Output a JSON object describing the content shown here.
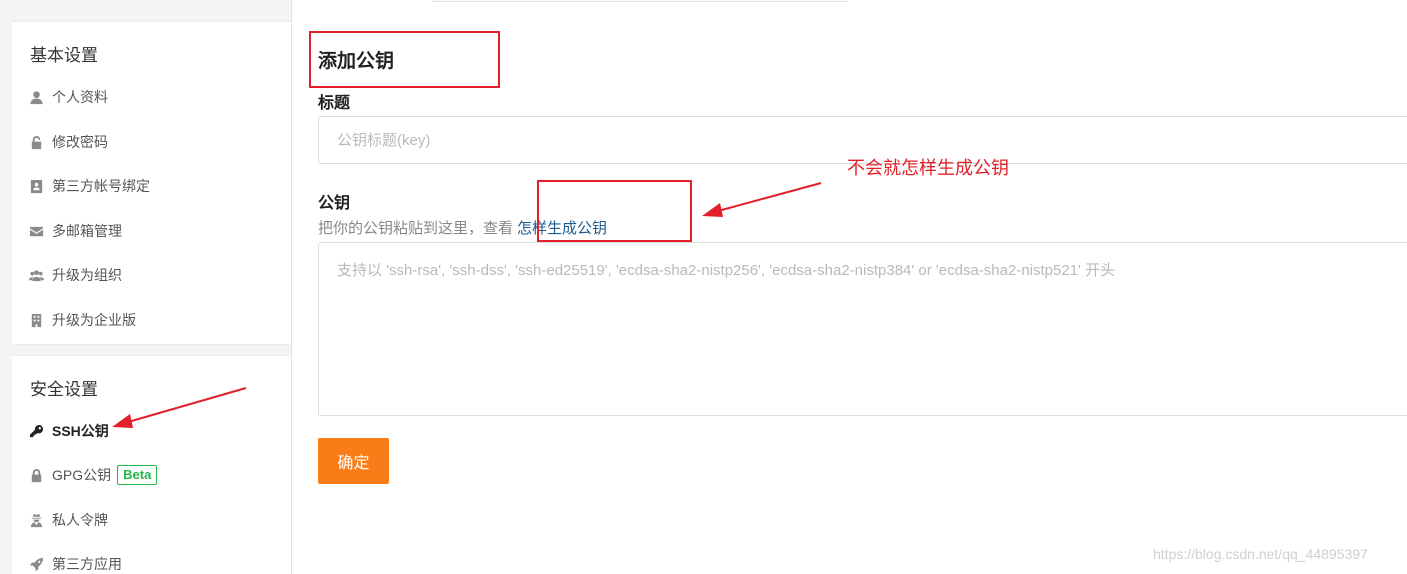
{
  "sidebar": {
    "basic_title": "基本设置",
    "basic_items": [
      {
        "label": "个人资料",
        "icon": "user-icon"
      },
      {
        "label": "修改密码",
        "icon": "unlock-icon"
      },
      {
        "label": "第三方帐号绑定",
        "icon": "id-card-icon"
      },
      {
        "label": "多邮箱管理",
        "icon": "envelope-icon"
      },
      {
        "label": "升级为组织",
        "icon": "users-icon"
      },
      {
        "label": "升级为企业版",
        "icon": "building-icon"
      }
    ],
    "security_title": "安全设置",
    "security_items": [
      {
        "label": "SSH公钥",
        "icon": "key-icon",
        "active": true
      },
      {
        "label": "GPG公钥",
        "icon": "lock-icon",
        "badge": "Beta"
      },
      {
        "label": "私人令牌",
        "icon": "user-secret-icon"
      },
      {
        "label": "第三方应用",
        "icon": "rocket-icon"
      }
    ]
  },
  "form": {
    "heading": "添加公钥",
    "title_label": "标题",
    "title_placeholder": "公钥标题(key)",
    "key_label": "公钥",
    "hint_text": "把你的公钥粘贴到这里，查看",
    "hint_link": "怎样生成公钥",
    "key_placeholder": "支持以 'ssh-rsa', 'ssh-dss', 'ssh-ed25519', 'ecdsa-sha2-nistp256', 'ecdsa-sha2-nistp384' or 'ecdsa-sha2-nistp521' 开头",
    "submit_label": "确定"
  },
  "annotations": {
    "note": "不会就怎样生成公钥",
    "color": "#e3202a"
  },
  "watermark": "https://blog.csdn.net/qq_44895397",
  "colors": {
    "accent_button": "#fa7c16",
    "link": "#1a5c91",
    "beta_badge": "#21ba45"
  }
}
